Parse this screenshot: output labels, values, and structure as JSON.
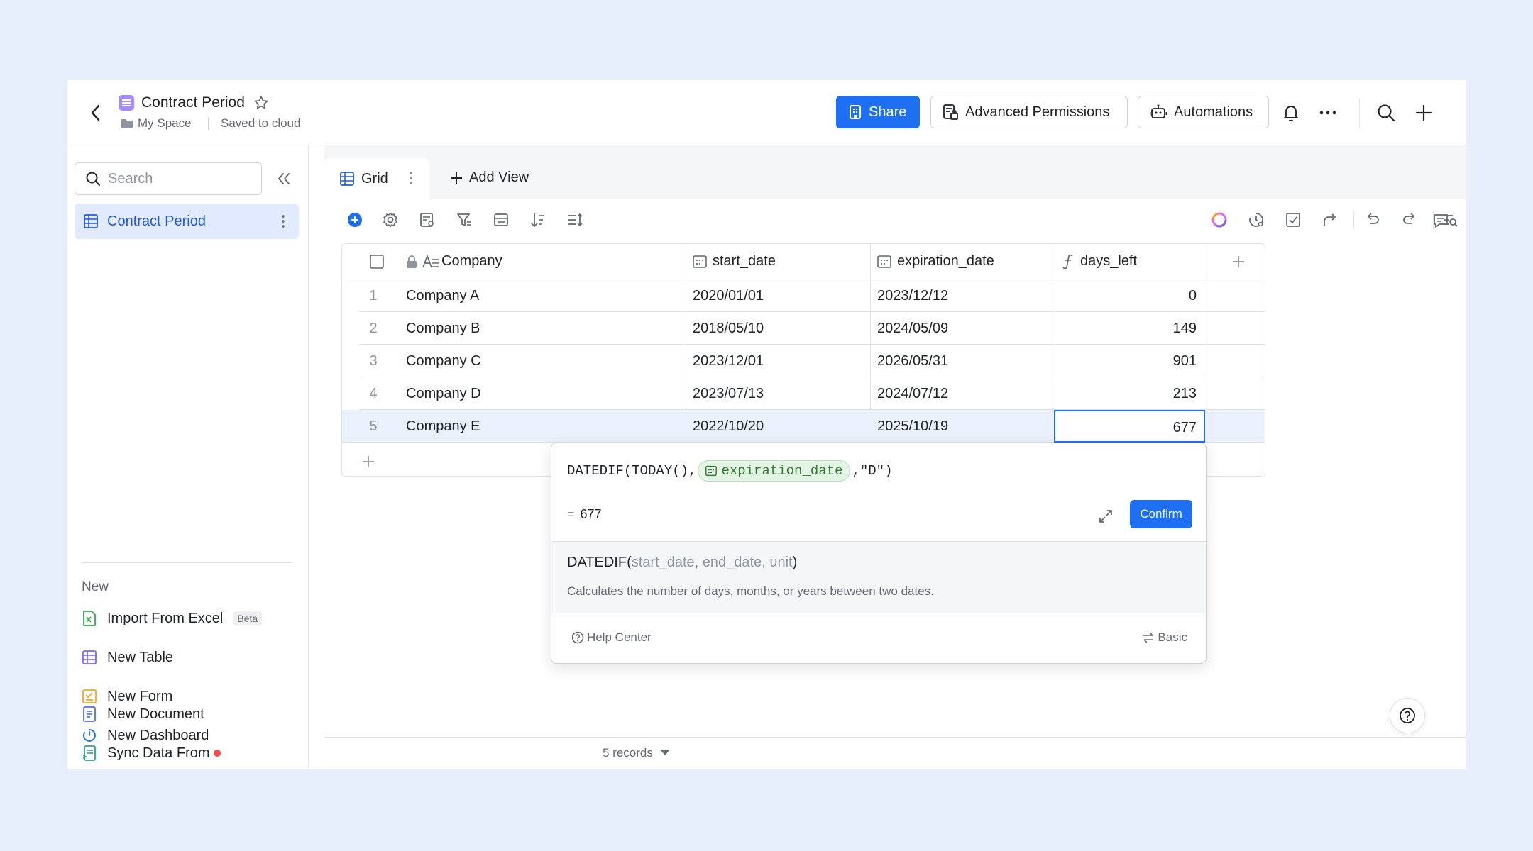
{
  "header": {
    "title": "Contract Period",
    "space": "My Space",
    "save_state": "Saved to cloud",
    "share_label": "Share",
    "permissions_label": "Advanced Permissions",
    "automations_label": "Automations"
  },
  "sidebar": {
    "search_placeholder": "Search",
    "active_item": "Contract Period",
    "new_label": "New",
    "new_items": [
      {
        "label": "Import From Excel",
        "icon": "excel-icon",
        "badge": "Beta"
      },
      {
        "label": "New Table",
        "icon": "table-icon"
      },
      {
        "label": "New Form",
        "icon": "form-icon"
      },
      {
        "label": "New Dashboard",
        "icon": "dashboard-icon"
      },
      {
        "label": "New Document",
        "icon": "document-icon"
      },
      {
        "label": "Sync Data From",
        "icon": "sync-icon"
      }
    ]
  },
  "views": {
    "active_tab": "Grid",
    "add_view_label": "Add View"
  },
  "grid": {
    "columns": [
      "Company",
      "start_date",
      "expiration_date",
      "days_left"
    ],
    "rows": [
      {
        "num": "1",
        "company": "Company A",
        "start_date": "2020/01/01",
        "expiration_date": "2023/12/12",
        "days_left": "0"
      },
      {
        "num": "2",
        "company": "Company B",
        "start_date": "2018/05/10",
        "expiration_date": "2024/05/09",
        "days_left": "149"
      },
      {
        "num": "3",
        "company": "Company C",
        "start_date": "2023/12/01",
        "expiration_date": "2026/05/31",
        "days_left": "901"
      },
      {
        "num": "4",
        "company": "Company D",
        "start_date": "2023/07/13",
        "expiration_date": "2024/07/12",
        "days_left": "213"
      },
      {
        "num": "5",
        "company": "Company E",
        "start_date": "2022/10/20",
        "expiration_date": "2025/10/19",
        "days_left": "677"
      }
    ]
  },
  "formula": {
    "prefix": "DATEDIF(TODAY(),",
    "field": "expiration_date",
    "suffix": ",\"D\")",
    "result_eq": "=",
    "result": "677",
    "confirm_label": "Confirm",
    "fn_name": "DATEDIF(",
    "arg1": "start_date",
    "arg2": "end_date",
    "arg3": "unit",
    "fn_close": ")",
    "sep": ", ",
    "description": "Calculates the number of days, months, or years between two dates.",
    "help_center_label": "Help Center",
    "basic_label": "Basic"
  },
  "footer": {
    "records_label": "5 records"
  },
  "colors": {
    "accent": "#1f6ff2",
    "sidebar_active_bg": "#e1eaff",
    "field_chip_bg": "#e4f5e5",
    "page_bg": "#e8effc"
  }
}
